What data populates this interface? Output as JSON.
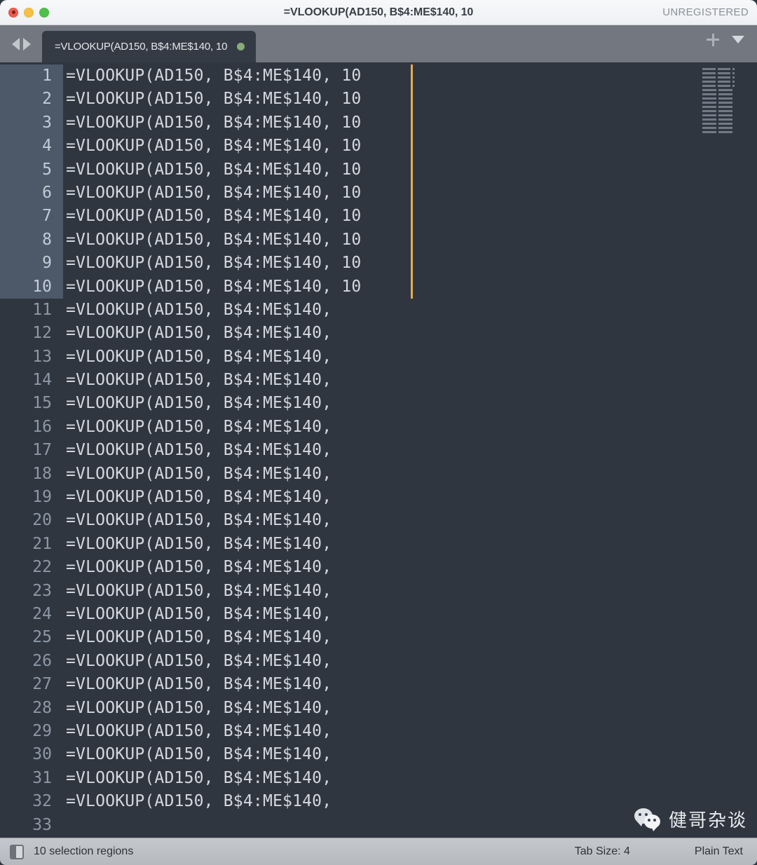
{
  "window": {
    "title": "=VLOOKUP(AD150, B$4:ME$140, 10",
    "unregistered_label": "UNREGISTERED",
    "traffic_lights": [
      "close-button",
      "minimize-button",
      "maximize-button"
    ]
  },
  "tabbar": {
    "nav_back": "back-arrow",
    "nav_forward": "forward-arrow",
    "tab_label": "=VLOOKUP(AD150, B$4:ME$140, 10",
    "dirty_indicator": "unsaved-dot",
    "new_tab": "plus-icon",
    "tab_menu": "chevron-down-icon"
  },
  "editor": {
    "full_line_text": "=VLOOKUP(AD150, B$4:ME$140, 10",
    "partial_line_text": "=VLOOKUP(AD150, B$4:ME$140, ",
    "empty_line_text": "",
    "total_lines": 33,
    "selected_lines": 10,
    "caret_color": "#e9a952",
    "lines": [
      {
        "n": 1,
        "text": "=VLOOKUP(AD150, B$4:ME$140, 10",
        "active": true
      },
      {
        "n": 2,
        "text": "=VLOOKUP(AD150, B$4:ME$140, 10",
        "active": true
      },
      {
        "n": 3,
        "text": "=VLOOKUP(AD150, B$4:ME$140, 10",
        "active": true
      },
      {
        "n": 4,
        "text": "=VLOOKUP(AD150, B$4:ME$140, 10",
        "active": true
      },
      {
        "n": 5,
        "text": "=VLOOKUP(AD150, B$4:ME$140, 10",
        "active": true
      },
      {
        "n": 6,
        "text": "=VLOOKUP(AD150, B$4:ME$140, 10",
        "active": true
      },
      {
        "n": 7,
        "text": "=VLOOKUP(AD150, B$4:ME$140, 10",
        "active": true
      },
      {
        "n": 8,
        "text": "=VLOOKUP(AD150, B$4:ME$140, 10",
        "active": true
      },
      {
        "n": 9,
        "text": "=VLOOKUP(AD150, B$4:ME$140, 10",
        "active": true
      },
      {
        "n": 10,
        "text": "=VLOOKUP(AD150, B$4:ME$140, 10",
        "active": true
      },
      {
        "n": 11,
        "text": "=VLOOKUP(AD150, B$4:ME$140, ",
        "active": false
      },
      {
        "n": 12,
        "text": "=VLOOKUP(AD150, B$4:ME$140, ",
        "active": false
      },
      {
        "n": 13,
        "text": "=VLOOKUP(AD150, B$4:ME$140, ",
        "active": false
      },
      {
        "n": 14,
        "text": "=VLOOKUP(AD150, B$4:ME$140, ",
        "active": false
      },
      {
        "n": 15,
        "text": "=VLOOKUP(AD150, B$4:ME$140, ",
        "active": false
      },
      {
        "n": 16,
        "text": "=VLOOKUP(AD150, B$4:ME$140, ",
        "active": false
      },
      {
        "n": 17,
        "text": "=VLOOKUP(AD150, B$4:ME$140, ",
        "active": false
      },
      {
        "n": 18,
        "text": "=VLOOKUP(AD150, B$4:ME$140, ",
        "active": false
      },
      {
        "n": 19,
        "text": "=VLOOKUP(AD150, B$4:ME$140, ",
        "active": false
      },
      {
        "n": 20,
        "text": "=VLOOKUP(AD150, B$4:ME$140, ",
        "active": false
      },
      {
        "n": 21,
        "text": "=VLOOKUP(AD150, B$4:ME$140, ",
        "active": false
      },
      {
        "n": 22,
        "text": "=VLOOKUP(AD150, B$4:ME$140, ",
        "active": false
      },
      {
        "n": 23,
        "text": "=VLOOKUP(AD150, B$4:ME$140, ",
        "active": false
      },
      {
        "n": 24,
        "text": "=VLOOKUP(AD150, B$4:ME$140, ",
        "active": false
      },
      {
        "n": 25,
        "text": "=VLOOKUP(AD150, B$4:ME$140, ",
        "active": false
      },
      {
        "n": 26,
        "text": "=VLOOKUP(AD150, B$4:ME$140, ",
        "active": false
      },
      {
        "n": 27,
        "text": "=VLOOKUP(AD150, B$4:ME$140, ",
        "active": false
      },
      {
        "n": 28,
        "text": "=VLOOKUP(AD150, B$4:ME$140, ",
        "active": false
      },
      {
        "n": 29,
        "text": "=VLOOKUP(AD150, B$4:ME$140, ",
        "active": false
      },
      {
        "n": 30,
        "text": "=VLOOKUP(AD150, B$4:ME$140, ",
        "active": false
      },
      {
        "n": 31,
        "text": "=VLOOKUP(AD150, B$4:ME$140, ",
        "active": false
      },
      {
        "n": 32,
        "text": "=VLOOKUP(AD150, B$4:ME$140, ",
        "active": false
      },
      {
        "n": 33,
        "text": "",
        "active": false
      }
    ]
  },
  "watermark": {
    "icon": "wechat-icon",
    "text": "健哥杂谈"
  },
  "statusbar": {
    "sidebar_toggle": "sidebar-toggle-icon",
    "selection_text": "10 selection regions",
    "tab_size": "Tab Size: 4",
    "syntax": "Plain Text"
  },
  "colors": {
    "editor_bg": "#2f3640",
    "gutter_highlight": "#4d5868",
    "tabbar_bg": "#727780",
    "tab_bg": "#343b45",
    "caret": "#e9a952",
    "dirty_dot": "#86ad78"
  }
}
